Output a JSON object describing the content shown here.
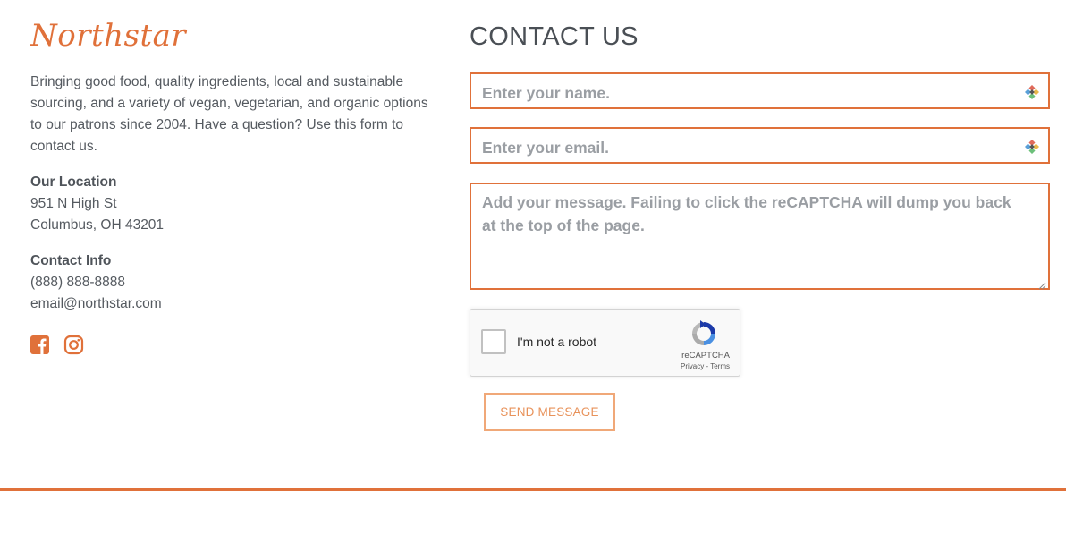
{
  "brand": {
    "logo_text": "Northstar",
    "accent": "#e0713a"
  },
  "about": {
    "text": "Bringing good food, quality ingredients, local and sustainable sourcing, and a variety of vegan, vegetarian, and organic options to our patrons since 2004. Have a question? Use this form to contact us."
  },
  "location": {
    "heading": "Our Location",
    "line1": "951 N High St",
    "line2": "Columbus, OH 43201"
  },
  "contact_info": {
    "heading": "Contact Info",
    "phone": "(888) 888-8888",
    "email": "email@northstar.com"
  },
  "social": {
    "icons": [
      "facebook-icon",
      "instagram-icon"
    ]
  },
  "form": {
    "title": "CONTACT US",
    "name_placeholder": "Enter your name.",
    "email_placeholder": "Enter your email.",
    "message_placeholder": "Add your message. Failing to click the reCAPTCHA will dump you back at the top of the page.",
    "submit_label": "SEND MESSAGE"
  },
  "recaptcha": {
    "label": "I'm not a robot",
    "brand": "reCAPTCHA",
    "links": "Privacy - Terms"
  }
}
